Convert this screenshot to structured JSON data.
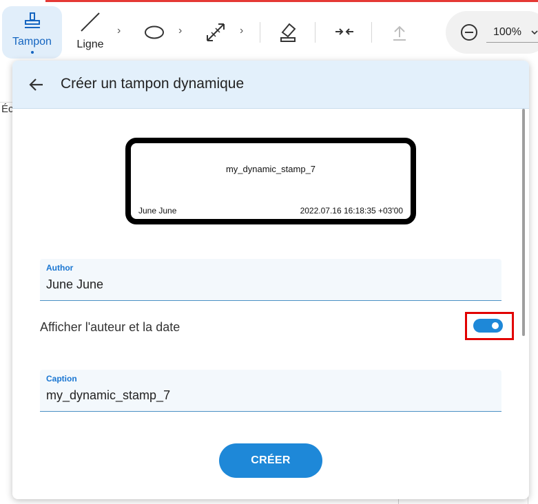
{
  "toolbar": {
    "stamp_label": "Tampon",
    "line_label": "Ligne",
    "zoom_value": "100%",
    "icons": [
      "stamp-icon",
      "line-icon",
      "ellipse-icon",
      "arrow-icon",
      "eraser-icon",
      "compress-icon",
      "upload-icon",
      "zoom-out-icon",
      "chevron-down-icon"
    ]
  },
  "background": {
    "partial_text": "Éc"
  },
  "modal": {
    "title": "Créer un tampon dynamique",
    "preview": {
      "caption": "my_dynamic_stamp_7",
      "author": "June June",
      "date": "2022.07.16 16:18:35 +03'00"
    },
    "author_field": {
      "label": "Author",
      "value": "June June"
    },
    "toggle": {
      "label": "Afficher l'auteur et la date",
      "on": true
    },
    "caption_field": {
      "label": "Caption",
      "value": "my_dynamic_stamp_7"
    },
    "create_label": "CRÉER"
  },
  "colors": {
    "accent": "#1e88d8",
    "header_bg": "#e3f0fb",
    "highlight": "#e10000",
    "top_accent": "#e53935"
  }
}
